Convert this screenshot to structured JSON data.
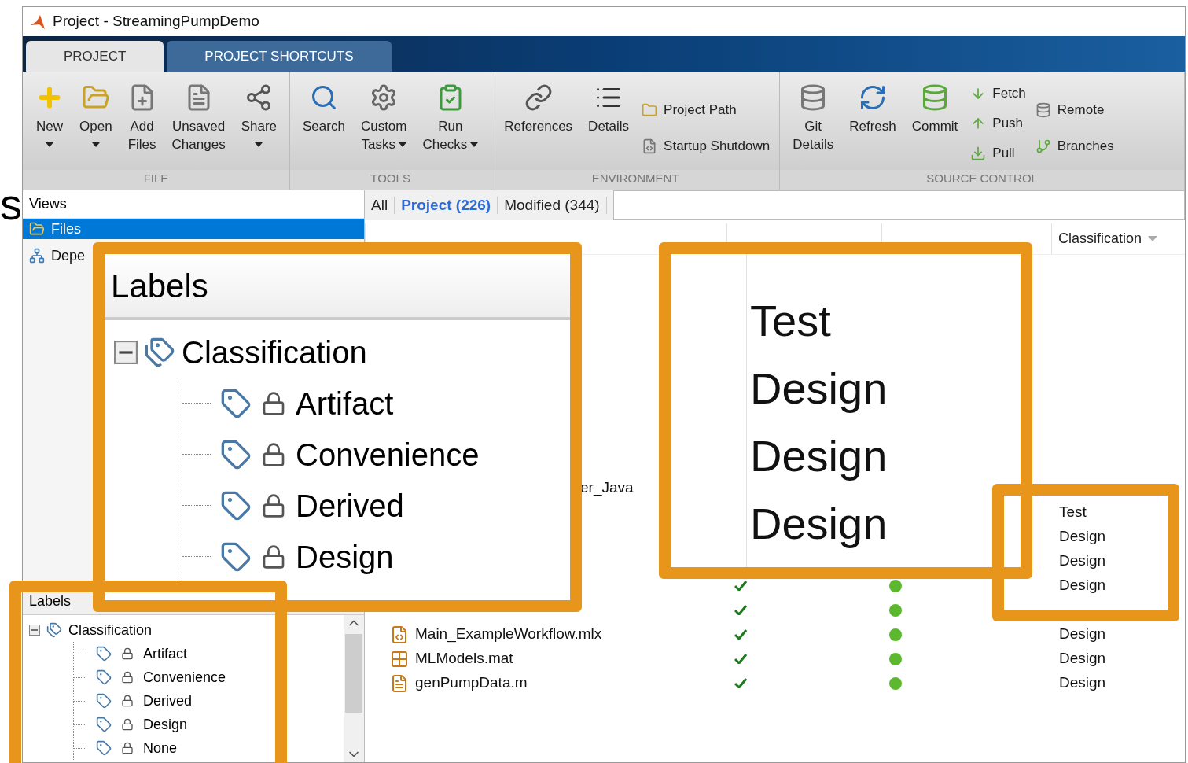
{
  "edge_text": "s",
  "window": {
    "title": "Project - StreamingPumpDemo"
  },
  "tabs": [
    {
      "label": "PROJECT",
      "selected": true
    },
    {
      "label": "PROJECT SHORTCUTS",
      "selected": false
    }
  ],
  "ribbon": [
    {
      "label": "FILE",
      "items": [
        {
          "kind": "large",
          "lines": [
            "New"
          ],
          "dropdown": true
        },
        {
          "kind": "large",
          "lines": [
            "Open"
          ],
          "dropdown": true
        },
        {
          "kind": "large",
          "lines": [
            "Add",
            "Files"
          ],
          "dropdown": false
        },
        {
          "kind": "large",
          "lines": [
            "Unsaved",
            "Changes"
          ],
          "dropdown": false
        },
        {
          "kind": "large",
          "lines": [
            "Share"
          ],
          "dropdown": true
        }
      ]
    },
    {
      "label": "TOOLS",
      "items": [
        {
          "kind": "large",
          "lines": [
            "Search"
          ],
          "dropdown": false
        },
        {
          "kind": "large",
          "lines": [
            "Custom",
            "Tasks"
          ],
          "dropdown": true
        },
        {
          "kind": "large",
          "lines": [
            "Run",
            "Checks"
          ],
          "dropdown": true
        }
      ]
    },
    {
      "label": "ENVIRONMENT",
      "items": [
        {
          "kind": "large",
          "lines": [
            "References"
          ],
          "dropdown": false
        },
        {
          "kind": "large",
          "lines": [
            "Details"
          ],
          "dropdown": false
        },
        {
          "kind": "stack",
          "items": [
            "Project Path",
            "Startup Shutdown"
          ]
        }
      ]
    },
    {
      "label": "SOURCE CONTROL",
      "items": [
        {
          "kind": "large",
          "lines": [
            "Git",
            "Details"
          ],
          "dropdown": false
        },
        {
          "kind": "large",
          "lines": [
            "Refresh"
          ],
          "dropdown": false
        },
        {
          "kind": "large",
          "lines": [
            "Commit"
          ],
          "dropdown": false
        },
        {
          "kind": "stack",
          "items": [
            "Fetch",
            "Push",
            "Pull"
          ]
        },
        {
          "kind": "stack",
          "items": [
            "Remote",
            "Branches"
          ]
        }
      ]
    }
  ],
  "views": {
    "title": "Views",
    "items": [
      {
        "label": "Files",
        "selected": true
      },
      {
        "label": "Depe",
        "selected": false
      }
    ]
  },
  "file_tabs": [
    {
      "label": "All",
      "selected": false
    },
    {
      "label": "Project (226)",
      "selected": true
    },
    {
      "label": "Modified (344)",
      "selected": false
    }
  ],
  "table": {
    "columns": [
      "",
      "",
      "",
      "Classification"
    ],
    "rows": [
      {
        "kind": "clipped",
        "name": "er_Java",
        "classification": ""
      },
      {
        "kind": "file",
        "name": "",
        "classification": "Test"
      },
      {
        "kind": "file",
        "name": "",
        "classification": "Design"
      },
      {
        "kind": "file",
        "name": "",
        "classification": "Design"
      },
      {
        "kind": "file",
        "name": "",
        "status": true,
        "git": true,
        "classification": "Design"
      },
      {
        "kind": "file",
        "name": "",
        "status": true,
        "git": true,
        "classification": ""
      },
      {
        "kind": "file",
        "name": "Main_ExampleWorkflow.mlx",
        "status": true,
        "git": true,
        "classification": "Design"
      },
      {
        "kind": "file",
        "name": "MLModels.mat",
        "status": true,
        "git": true,
        "classification": "Design"
      },
      {
        "kind": "file",
        "name": "genPumpData.m",
        "status": true,
        "git": true,
        "classification": "Design"
      }
    ]
  },
  "labels": {
    "title": "Labels",
    "root": {
      "label": "Classification",
      "expanded": true,
      "children": [
        {
          "label": "Artifact"
        },
        {
          "label": "Convenience"
        },
        {
          "label": "Derived"
        },
        {
          "label": "Design"
        },
        {
          "label": "None"
        }
      ]
    }
  },
  "zoom_labels": {
    "title": "Labels",
    "root": {
      "label": "Classification",
      "expanded": true,
      "children": [
        {
          "label": "Artifact"
        },
        {
          "label": "Convenience"
        },
        {
          "label": "Derived"
        },
        {
          "label": "Design"
        }
      ]
    }
  },
  "zoom_classification": [
    "Test",
    "Design",
    "Design",
    "Design"
  ]
}
